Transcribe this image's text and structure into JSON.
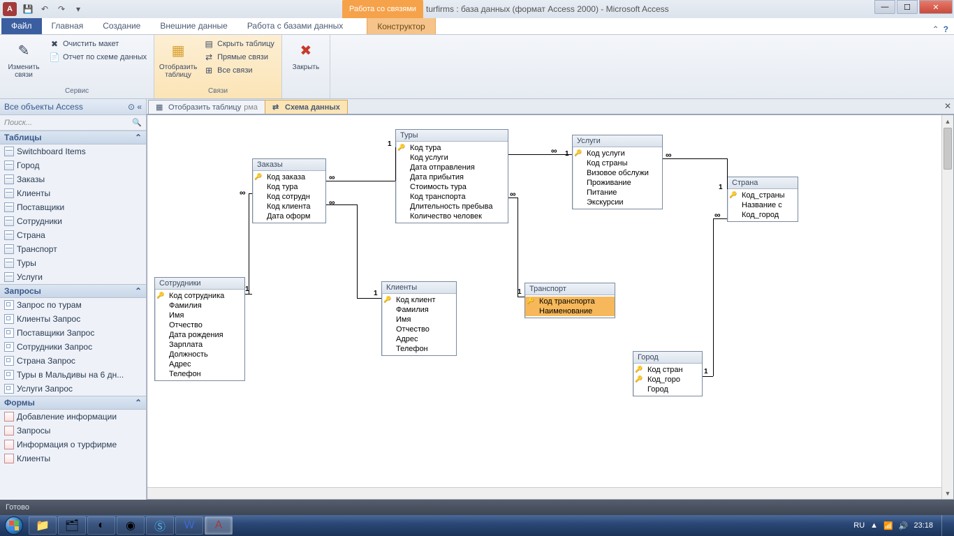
{
  "titlebar": {
    "context_tab": "Работа со связями",
    "doc_title": "turfirms : база данных (формат Access 2000)  -  Microsoft Access",
    "app_letter": "A"
  },
  "ribbon_tabs": {
    "file": "Файл",
    "tabs": [
      "Главная",
      "Создание",
      "Внешние данные",
      "Работа с базами данных"
    ],
    "context": "Конструктор"
  },
  "ribbon": {
    "group1": {
      "big": "Изменить\nсвязи",
      "clear": "Очистить макет",
      "report": "Отчет по схеме данных",
      "label": "Сервис"
    },
    "group2": {
      "big": "Отобразить\nтаблицу",
      "hide": "Скрыть таблицу",
      "direct": "Прямые связи",
      "all": "Все связи",
      "label": "Связи"
    },
    "group3": {
      "big": "Закрыть"
    }
  },
  "nav": {
    "header": "Все объекты Access",
    "groups": {
      "tables": {
        "title": "Таблицы",
        "items": [
          "Switchboard Items",
          "Город",
          "Заказы",
          "Клиенты",
          "Поставщики",
          "Сотрудники",
          "Страна",
          "Транспорт",
          "Туры",
          "Услуги"
        ]
      },
      "queries": {
        "title": "Запросы",
        "items": [
          "Запрос по турам",
          "Клиенты Запрос",
          "Поставщики Запрос",
          "Сотрудники Запрос",
          "Страна Запрос",
          "Туры в Мальдивы на 6 дн...",
          "Услуги Запрос"
        ]
      },
      "forms": {
        "title": "Формы",
        "items": [
          "Добавление информации",
          "Запросы",
          "Информация о турфирме",
          "Клиенты"
        ]
      }
    }
  },
  "doc_tabs": {
    "t1": "Отобразить таблицу",
    "t1_suffix": "рма",
    "t2": "Схема данных"
  },
  "tables": {
    "zakazy": {
      "title": "Заказы",
      "fields": [
        "Код заказа",
        "Код тура",
        "Код сотрудн",
        "Код клиента",
        "Дата оформ"
      ]
    },
    "tury": {
      "title": "Туры",
      "fields": [
        "Код тура",
        "Код услуги",
        "Дата отправления",
        "Дата прибытия",
        "Стоимость тура",
        "Код транспорта",
        "Длительность пребыва",
        "Количество человек"
      ]
    },
    "uslugi": {
      "title": "Услуги",
      "fields": [
        "Код услуги",
        "Код страны",
        "Визовое обслужи",
        "Проживание",
        "Питание",
        "Экскурсии"
      ]
    },
    "strana": {
      "title": "Страна",
      "fields": [
        "Код_страны",
        "Название с",
        "Код_город"
      ]
    },
    "sotrudniki": {
      "title": "Сотрудники",
      "fields": [
        "Код сотрудника",
        "Фамилия",
        "Имя",
        "Отчество",
        "Дата рождения",
        "Зарплата",
        "Должность",
        "Адрес",
        "Телефон"
      ]
    },
    "klienty": {
      "title": "Клиенты",
      "fields": [
        "Код клиент",
        "Фамилия",
        "Имя",
        "Отчество",
        "Адрес",
        "Телефон"
      ]
    },
    "transport": {
      "title": "Транспорт",
      "fields": [
        "Код транспорта",
        "Наименование"
      ]
    },
    "gorod": {
      "title": "Город",
      "fields": [
        "Код стран",
        "Код_горо",
        "Город"
      ]
    }
  },
  "rel_labels": {
    "one": "1",
    "inf": "∞"
  },
  "status": {
    "text": "Готово"
  },
  "tray": {
    "lang": "RU",
    "time": "23:18"
  }
}
